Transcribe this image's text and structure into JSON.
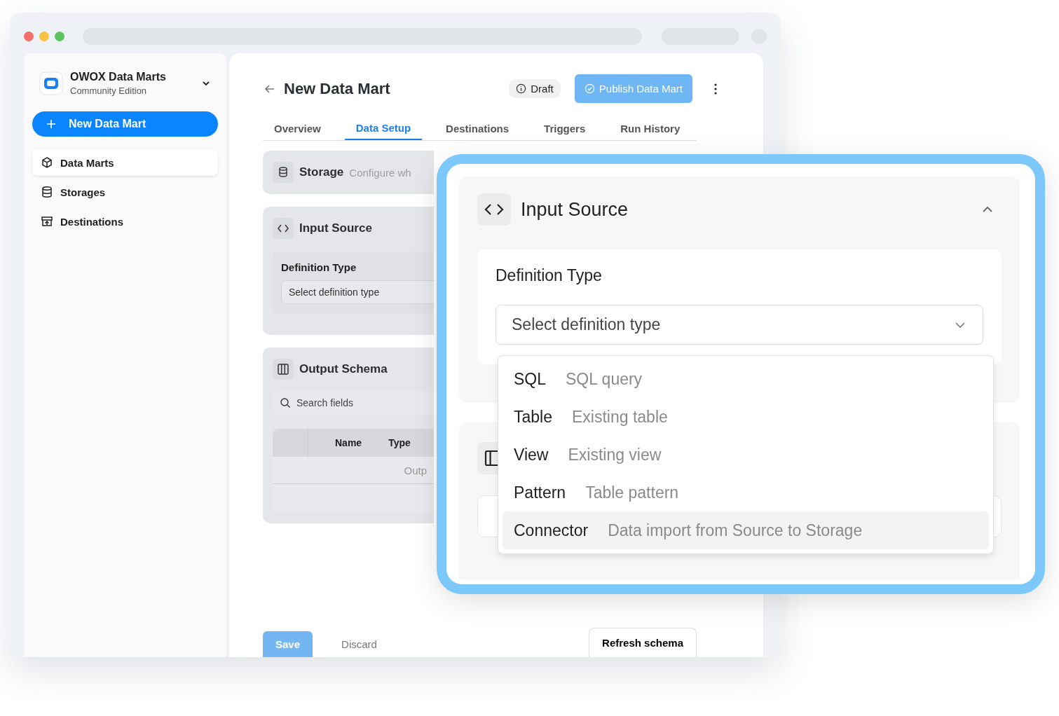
{
  "sidebar": {
    "workspace": {
      "name": "OWOX Data Marts",
      "edition": "Community Edition"
    },
    "new_button": "New Data Mart",
    "items": [
      {
        "label": "Data Marts",
        "selected": true
      },
      {
        "label": "Storages",
        "selected": false
      },
      {
        "label": "Destinations",
        "selected": false
      }
    ]
  },
  "header": {
    "title": "New Data Mart",
    "status": "Draft",
    "publish": "Publish Data Mart"
  },
  "tabs": [
    {
      "label": "Overview",
      "selected": false
    },
    {
      "label": "Data Setup",
      "selected": true
    },
    {
      "label": "Destinations",
      "selected": false
    },
    {
      "label": "Triggers",
      "selected": false
    },
    {
      "label": "Run History",
      "selected": false
    }
  ],
  "storage": {
    "title": "Storage",
    "description": "Configure wh"
  },
  "input_source": {
    "title": "Input Source",
    "definition_label": "Definition Type",
    "select_placeholder": "Select definition type"
  },
  "output_schema": {
    "title": "Output Schema",
    "search_placeholder": "Search fields",
    "columns": [
      "Name",
      "Type"
    ],
    "row_text": "Outp"
  },
  "footer": {
    "save": "Save",
    "discard": "Discard",
    "refresh": "Refresh schema"
  },
  "callout": {
    "title": "Input Source",
    "expanded": true,
    "definition_label": "Definition Type",
    "select_placeholder": "Select definition type",
    "options": [
      {
        "name": "SQL",
        "description": "SQL query",
        "selected": false
      },
      {
        "name": "Table",
        "description": "Existing table",
        "selected": false
      },
      {
        "name": "View",
        "description": "Existing view",
        "selected": false
      },
      {
        "name": "Pattern",
        "description": "Table pattern",
        "selected": false
      },
      {
        "name": "Connector",
        "description": "Data import from Source to Storage",
        "selected": true
      }
    ]
  }
}
